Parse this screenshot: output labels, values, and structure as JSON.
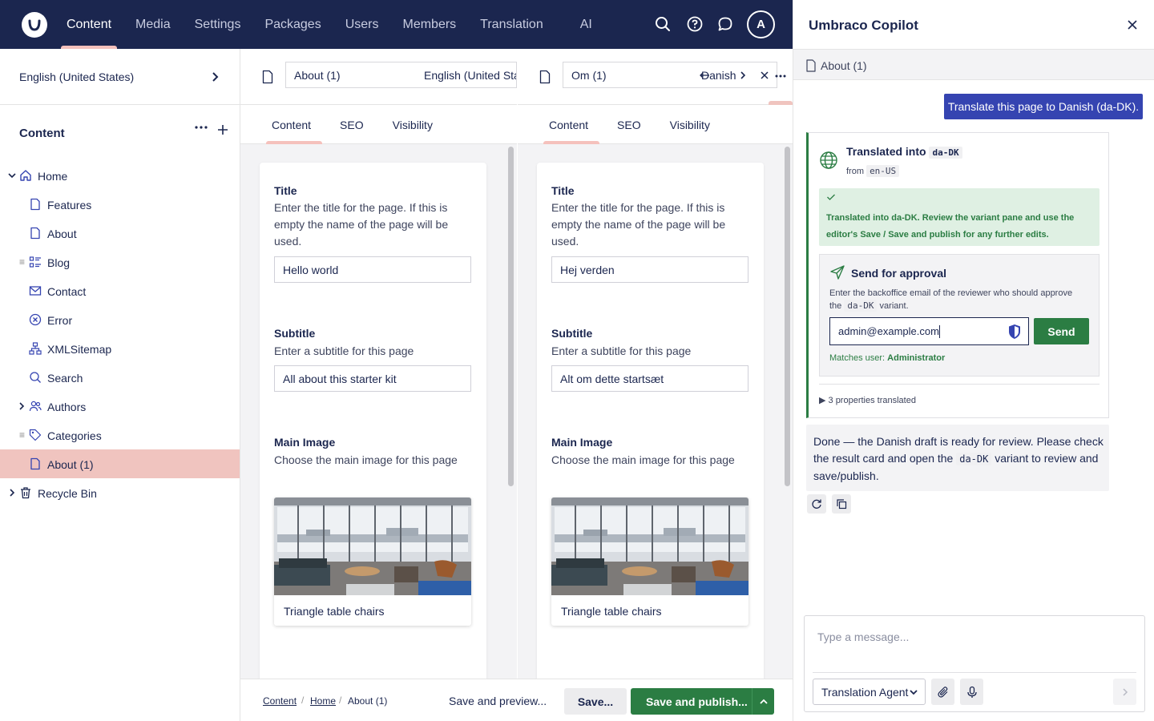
{
  "topbar": {
    "nav": [
      "Content",
      "Media",
      "Settings",
      "Packages",
      "Users",
      "Members",
      "Translation",
      "AI"
    ],
    "active": "Content",
    "avatar_initial": "A"
  },
  "sidebar": {
    "language": "English (United States)",
    "section_title": "Content",
    "tree": [
      {
        "label": "Home",
        "icon": "home-icon"
      },
      {
        "label": "Features",
        "icon": "document-icon"
      },
      {
        "label": "About",
        "icon": "document-icon"
      },
      {
        "label": "Blog",
        "icon": "list-icon"
      },
      {
        "label": "Contact",
        "icon": "envelope-icon"
      },
      {
        "label": "Error",
        "icon": "error-circle-icon"
      },
      {
        "label": "XMLSitemap",
        "icon": "sitemap-icon"
      },
      {
        "label": "Search",
        "icon": "search-icon"
      },
      {
        "label": "Authors",
        "icon": "users-icon"
      },
      {
        "label": "Categories",
        "icon": "tag-icon"
      },
      {
        "label": "About (1)",
        "icon": "document-icon",
        "active": true
      },
      {
        "label": "Recycle Bin",
        "icon": "trash-icon"
      }
    ]
  },
  "left_pane": {
    "name": "About (1)",
    "language": "English (United Sta",
    "tabs": [
      "Content",
      "SEO",
      "Visibility"
    ],
    "fields": {
      "title_label": "Title",
      "title_desc": "Enter the title for the page. If this is empty the name of the page will be used.",
      "title_value": "Hello world",
      "subtitle_label": "Subtitle",
      "subtitle_desc": "Enter a subtitle for this page",
      "subtitle_value": "All about this starter kit",
      "image_label": "Main Image",
      "image_desc": "Choose the main image for this page",
      "image_caption": "Triangle table chairs"
    }
  },
  "right_pane": {
    "name": "Om (1)",
    "language": "Danish",
    "tabs": [
      "Content",
      "SEO",
      "Visibility"
    ],
    "fields": {
      "title_label": "Title",
      "title_desc": "Enter the title for the page. If this is empty the name of the page will be used.",
      "title_value": "Hej verden",
      "subtitle_label": "Subtitle",
      "subtitle_desc": "Enter a subtitle for this page",
      "subtitle_value": "Alt om dette startsæt",
      "image_label": "Main Image",
      "image_desc": "Choose the main image for this page",
      "image_caption": "Triangle table chairs"
    }
  },
  "footer": {
    "breadcrumb": [
      "Content",
      "Home",
      "About (1)"
    ],
    "preview_label": "Save and preview...",
    "save_label": "Save...",
    "publish_label": "Save and publish..."
  },
  "copilot": {
    "title": "Umbraco Copilot",
    "context": "About (1)",
    "user_message": "Translate this page to Danish (da-DK).",
    "result": {
      "title": "Translated into",
      "target_code": "da-DK",
      "from_label": "from",
      "source_code": "en-US",
      "success_text": "Translated into da-DK. Review the variant pane and use the editor's Save / Save and publish for any further edits.",
      "approval_title": "Send for approval",
      "approval_desc_1": "Enter the backoffice email of the reviewer who should approve the",
      "approval_code": "da-DK",
      "approval_desc_2": "variant.",
      "email_value": "admin@example.com",
      "send_label": "Send",
      "match_prefix": "Matches user:",
      "match_user": "Administrator",
      "properties": "3 properties translated"
    },
    "bot_message_1": "Done — the Danish draft is ready for review. Please check the result card and open the",
    "bot_code": "da-DK",
    "bot_message_2": "variant to review and save/publish.",
    "composer_placeholder": "Type a message...",
    "agent": "Translation Agent"
  },
  "colors": {
    "topbar": "#1b264f",
    "accent_tab": "#f5c1bc",
    "active_tree": "#f0c4bf",
    "publish_green": "#2b7d43",
    "user_bubble": "#3544b1"
  }
}
